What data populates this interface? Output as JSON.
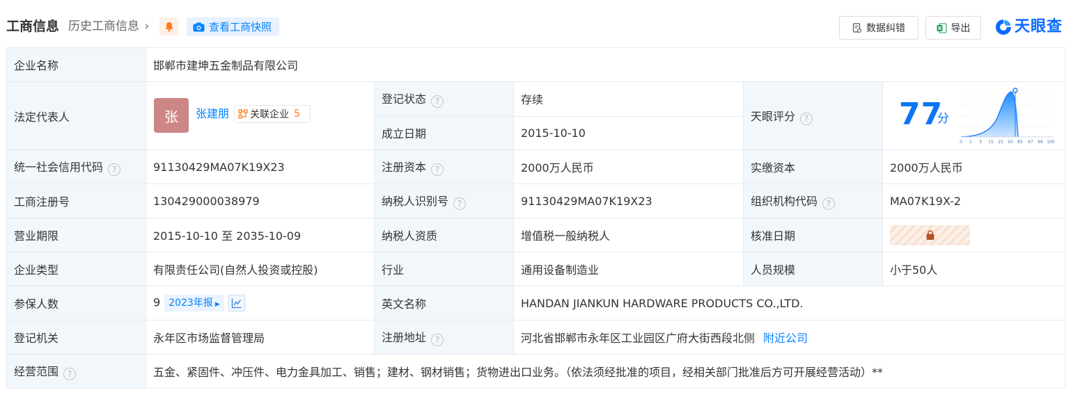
{
  "header": {
    "title": "工商信息",
    "history": "历史工商信息",
    "snapshot": "查看工商快照",
    "feedback": "数据纠错",
    "export": "导出",
    "logo": "天眼查"
  },
  "table": {
    "company_name": {
      "label": "企业名称",
      "value": "邯郸市建坤五金制品有限公司"
    },
    "legal_rep": {
      "label": "法定代表人",
      "avatar": "张",
      "name": "张建朋",
      "assoc_label": "关联企业",
      "assoc_count": "5"
    },
    "reg_status": {
      "label": "登记状态",
      "value": "存续"
    },
    "est_date": {
      "label": "成立日期",
      "value": "2015-10-10"
    },
    "score": {
      "label": "天眼评分",
      "value": "77",
      "unit": "分",
      "ticks": [
        "0",
        "1",
        "3",
        "15",
        "25",
        "50",
        "85",
        "97",
        "99",
        "100"
      ]
    },
    "credit_code": {
      "label": "统一社会信用代码",
      "value": "91130429MA07K19X23"
    },
    "reg_capital": {
      "label": "注册资本",
      "value": "2000万人民币"
    },
    "paid_capital": {
      "label": "实缴资本",
      "value": "2000万人民币"
    },
    "reg_no": {
      "label": "工商注册号",
      "value": "130429000038979"
    },
    "taxpayer_id": {
      "label": "纳税人识别号",
      "value": "91130429MA07K19X23"
    },
    "org_code": {
      "label": "组织机构代码",
      "value": "MA07K19X-2"
    },
    "term": {
      "label": "营业期限",
      "value": "2015-10-10 至 2035-10-09"
    },
    "tax_qual": {
      "label": "纳税人资质",
      "value": "增值税一般纳税人"
    },
    "approval_date": {
      "label": "核准日期"
    },
    "company_type": {
      "label": "企业类型",
      "value": "有限责任公司(自然人投资或控股)"
    },
    "industry": {
      "label": "行业",
      "value": "通用设备制造业"
    },
    "staff_size": {
      "label": "人员规模",
      "value": "小于50人"
    },
    "insured": {
      "label": "参保人数",
      "value": "9",
      "year_tag": "2023年报"
    },
    "english_name": {
      "label": "英文名称",
      "value": "HANDAN JIANKUN HARDWARE PRODUCTS CO.,LTD."
    },
    "reg_authority": {
      "label": "登记机关",
      "value": "永年区市场监督管理局"
    },
    "reg_address": {
      "label": "注册地址",
      "value": "河北省邯郸市永年区工业园区广府大街西段北侧",
      "nearby": "附近公司"
    },
    "scope": {
      "label": "经营范围",
      "value": "五金、紧固件、冲压件、电力金具加工、销售；建材、钢材销售；货物进出口业务。（依法须经批准的项目，经相关部门批准后方可开展经营活动）**"
    }
  },
  "colors": {
    "accent": "#0084ff",
    "label_bg": "#f2f7fc",
    "status_green": "#2ba34d",
    "score_blue": "#0a75f5",
    "avatar_bg": "#cd8686"
  },
  "icons": {
    "bell": "bell-icon",
    "camera": "camera-icon",
    "feedback": "document-edit-icon",
    "export": "excel-icon",
    "logo": "tianyancha-logo-icon",
    "help": "question-circle-icon",
    "assoc": "network-icon",
    "lock": "lock-icon",
    "trend": "trend-chart-icon"
  }
}
